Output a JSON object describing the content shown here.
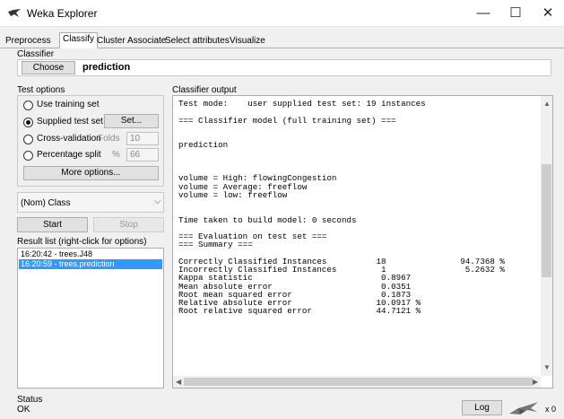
{
  "window": {
    "title": "Weka Explorer",
    "minimize": "—",
    "maximize": "☐",
    "close": "✕"
  },
  "tabs": [
    {
      "label": "Preprocess"
    },
    {
      "label": "Classify"
    },
    {
      "label": "Cluster"
    },
    {
      "label": "Associate"
    },
    {
      "label": "Select attributes"
    },
    {
      "label": "Visualize"
    }
  ],
  "active_tab": "Classify",
  "classifier": {
    "section_label": "Classifier",
    "choose_label": "Choose",
    "name": "prediction"
  },
  "test_options": {
    "section_label": "Test options",
    "use_training_set": "Use training set",
    "supplied_test_set": "Supplied test set",
    "set_button": "Set...",
    "cross_validation": "Cross-validation",
    "folds_label": "Folds",
    "folds_value": "10",
    "percentage_split": "Percentage split",
    "percent_sign": "%",
    "percent_value": "66",
    "more_options": "More options...",
    "selected": "supplied_test_set"
  },
  "class_select": {
    "value": "(Nom) Class"
  },
  "actions": {
    "start": "Start",
    "stop": "Stop"
  },
  "result_list": {
    "label": "Result list (right-click for options)",
    "items": [
      {
        "label": "16:20:42 - trees.J48",
        "selected": false
      },
      {
        "label": "16:20:59 - trees.prediction",
        "selected": true
      }
    ]
  },
  "output": {
    "label": "Classifier output",
    "lines": [
      "Test mode:    user supplied test set: 19 instances",
      "",
      "=== Classifier model (full training set) ===",
      "",
      "",
      "prediction",
      "",
      "",
      "",
      "volume = High: flowingCongestion",
      "volume = Average: freeflow",
      "volume = low: freeflow",
      "",
      "",
      "Time taken to build model: 0 seconds",
      "",
      "=== Evaluation on test set ===",
      "=== Summary ===",
      "",
      "Correctly Classified Instances          18               94.7368 %",
      "Incorrectly Classified Instances         1                5.2632 %",
      "Kappa statistic                          0.8967",
      "Mean absolute error                      0.0351",
      "Root mean squared error                  0.1873",
      "Relative absolute error                 10.0917 %",
      "Root relative squared error             44.7121 %"
    ]
  },
  "status": {
    "label": "Status",
    "value": "OK",
    "log_button": "Log",
    "count": "x 0"
  }
}
